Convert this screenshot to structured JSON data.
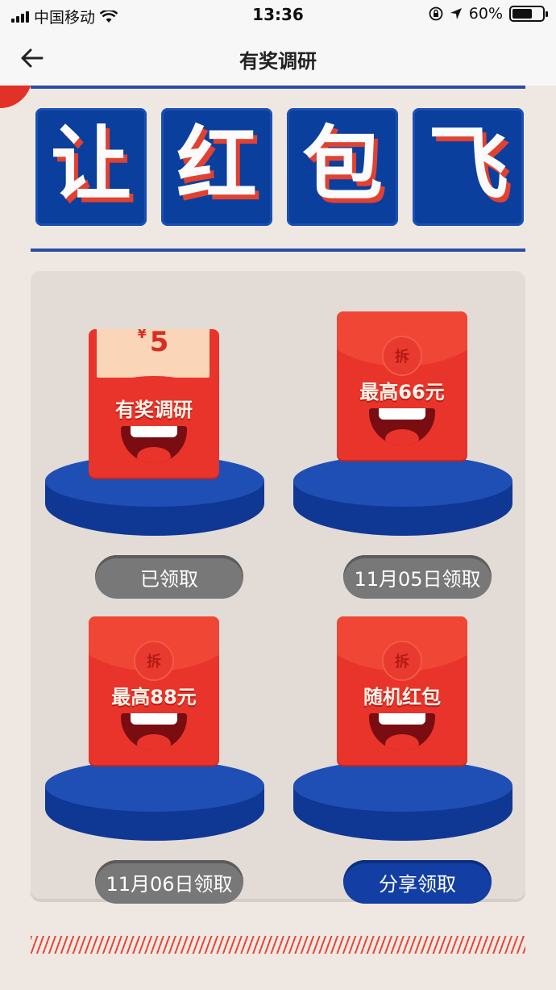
{
  "status_bar": {
    "carrier": "中国移动",
    "time": "13:36",
    "battery_percent": "60%",
    "battery_level": 0.6,
    "icons": [
      "signal-icon",
      "wifi-icon",
      "orientation-lock-icon",
      "location-icon",
      "battery-icon"
    ]
  },
  "nav": {
    "title": "有奖调研",
    "back_icon": "back-arrow-icon"
  },
  "banner": {
    "chars": [
      "让",
      "红",
      "包",
      "飞"
    ]
  },
  "rewards": [
    {
      "paper_amount": "5",
      "currency": "¥",
      "envelope_text": "有奖调研",
      "button_label": "已领取",
      "button_state": "claimed"
    },
    {
      "envelope_text": "最高66元",
      "seal": "拆",
      "button_label": "11月05日领取",
      "button_state": "pending"
    },
    {
      "envelope_text": "最高88元",
      "seal": "拆",
      "button_label": "11月06日领取",
      "button_state": "pending"
    },
    {
      "envelope_text": "随机红包",
      "seal": "拆",
      "button_label": "分享领取",
      "button_state": "active"
    }
  ],
  "colors": {
    "red": "#e8342b",
    "blue": "#0b3f9d",
    "gray_button": "#787878",
    "blue_button": "#133fa4",
    "background": "#efe8e2"
  }
}
